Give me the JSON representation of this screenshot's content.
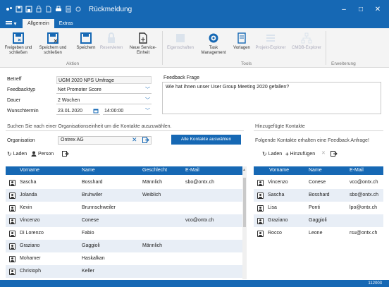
{
  "window": {
    "title": "Rückmeldung",
    "minimize": "–",
    "maximize": "□",
    "close": "✕"
  },
  "tabs": {
    "file": "▾",
    "items": [
      {
        "label": "Allgemein",
        "active": true
      },
      {
        "label": "Extras",
        "active": false
      }
    ]
  },
  "ribbon": {
    "buttons": {
      "save_close": "Freigeben und schließen",
      "save_and_close": "Speichern und schließen",
      "save": "Speichern",
      "reserve": "Reservieren",
      "new_service": "Neue Service-Einheit",
      "properties": "Eigenschaften",
      "task_mgmt": "Task Management",
      "templates": "Vorlagen",
      "project_explorer": "Projekt-Explorer",
      "cmdb_explorer": "CMDB-Explorer"
    },
    "groups": {
      "action": "Aktion",
      "tools": "Tools",
      "extension": "Erweiterung"
    }
  },
  "form": {
    "subject_label": "Betreff",
    "subject_value": "UGM 2020 NPS Umfrage",
    "type_label": "Feedbacktyp",
    "type_value": "Net Promoter Score",
    "duration_label": "Dauer",
    "duration_value": "2 Wochen",
    "date_label": "Wunschtermin",
    "date_value": "23.01.2020",
    "time_value": "14:00:00",
    "question_label": "Feedback Frage",
    "question_value": "Wie hat ihnen unser User Group Meeting 2020 gefallen?"
  },
  "left_panel": {
    "search_title": "Suchen Sie nach einer Organisationseinheit um die Kontakte auszuwählen.",
    "org_label": "Organisation",
    "org_value": "Ontrex AG",
    "select_all": "Alle Kontakte auswählen",
    "toolbar": {
      "load": "Laden",
      "person": "Person"
    },
    "columns": [
      "Vorname",
      "Name",
      "Geschlecht",
      "E-Mail"
    ],
    "rows": [
      [
        "Sascha",
        "Bosshard",
        "Männlich",
        "sbo@ontx.ch"
      ],
      [
        "Jolanda",
        "Bruhwiler",
        "Weiblich",
        ""
      ],
      [
        "Kevin",
        "Brunnschweiler",
        "",
        ""
      ],
      [
        "Vincenzo",
        "Conese",
        "",
        "vco@ontx.ch"
      ],
      [
        "Di Lorenzo",
        "Fabio",
        "",
        ""
      ],
      [
        "Graziano",
        "Gaggioli",
        "Männlich",
        ""
      ],
      [
        "Mohamer",
        "Haskalkan",
        "",
        ""
      ],
      [
        "Christoph",
        "Keller",
        "",
        ""
      ]
    ]
  },
  "right_panel": {
    "title": "Hinzugefügte Kontakte",
    "subtitle": "Folgende Kontakte erhalten eine Feedback Anfrage!",
    "toolbar": {
      "load": "Laden",
      "add": "Hinzufügen"
    },
    "columns": [
      "Vorname",
      "Name",
      "E-Mail"
    ],
    "rows": [
      [
        "Vincenzo",
        "Conese",
        "vco@ontx.ch"
      ],
      [
        "Sascha",
        "Bosshard",
        "sbo@ontx.ch"
      ],
      [
        "Lisa",
        "Ponti",
        "lpo@ontx.ch"
      ],
      [
        "Graziano",
        "Gaggioli",
        ""
      ],
      [
        "Rocco",
        "Leone",
        "rsu@ontx.ch"
      ]
    ]
  },
  "status": {
    "text": "112003"
  },
  "colors": {
    "accent": "#1668b4",
    "row_alt": "#e8eef6"
  }
}
